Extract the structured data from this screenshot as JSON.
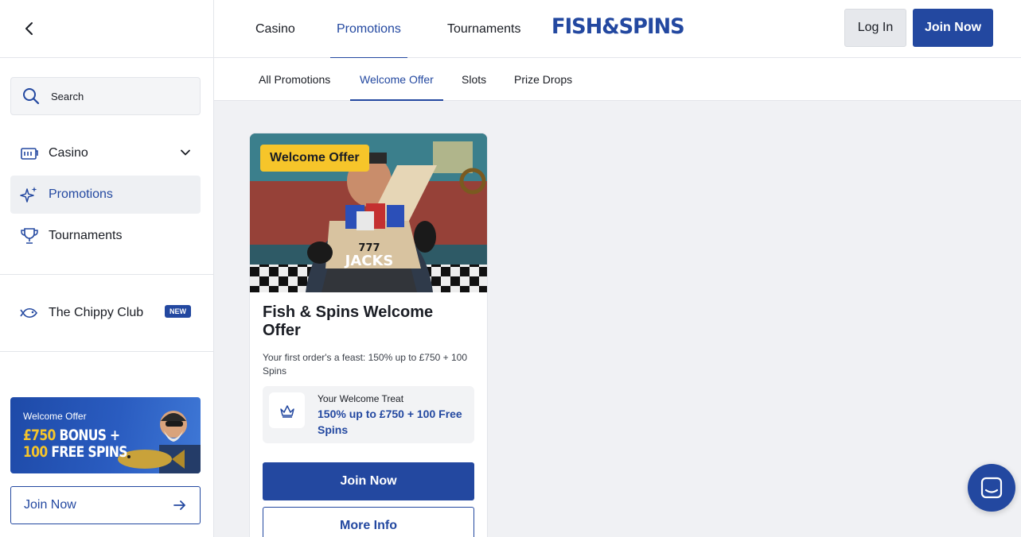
{
  "sidebar": {
    "search_placeholder": "Search",
    "items": [
      {
        "label": "Casino"
      },
      {
        "label": "Promotions"
      },
      {
        "label": "Tournaments"
      }
    ],
    "club": {
      "label": "The Chippy Club",
      "badge": "NEW"
    },
    "banner": {
      "small": "Welcome Offer",
      "amount": "£750",
      "line1_rest": "BONUS +",
      "spins_count": "100",
      "line2_rest": "FREE SPINS"
    },
    "join_label": "Join Now"
  },
  "header": {
    "tabs": [
      {
        "label": "Casino"
      },
      {
        "label": "Promotions"
      },
      {
        "label": "Tournaments"
      }
    ],
    "logo": "FISH&SPINS",
    "login_label": "Log In",
    "join_label": "Join Now"
  },
  "subnav": {
    "tabs": [
      {
        "label": "All Promotions"
      },
      {
        "label": "Welcome Offer"
      },
      {
        "label": "Slots"
      },
      {
        "label": "Prize Drops"
      }
    ]
  },
  "card": {
    "tag": "Welcome Offer",
    "box_brand": "JACKS",
    "box_number": "777",
    "title": "Fish & Spins Welcome Offer",
    "description": "Your first order's a feast: 150% up to £750 + 100 Spins",
    "treat_label": "Your Welcome Treat",
    "treat_value": "150% up to £750 + 100 Free Spins",
    "join_label": "Join Now",
    "more_label": "More Info"
  },
  "colors": {
    "brand": "#2348a0",
    "accent": "#f6c52a"
  }
}
